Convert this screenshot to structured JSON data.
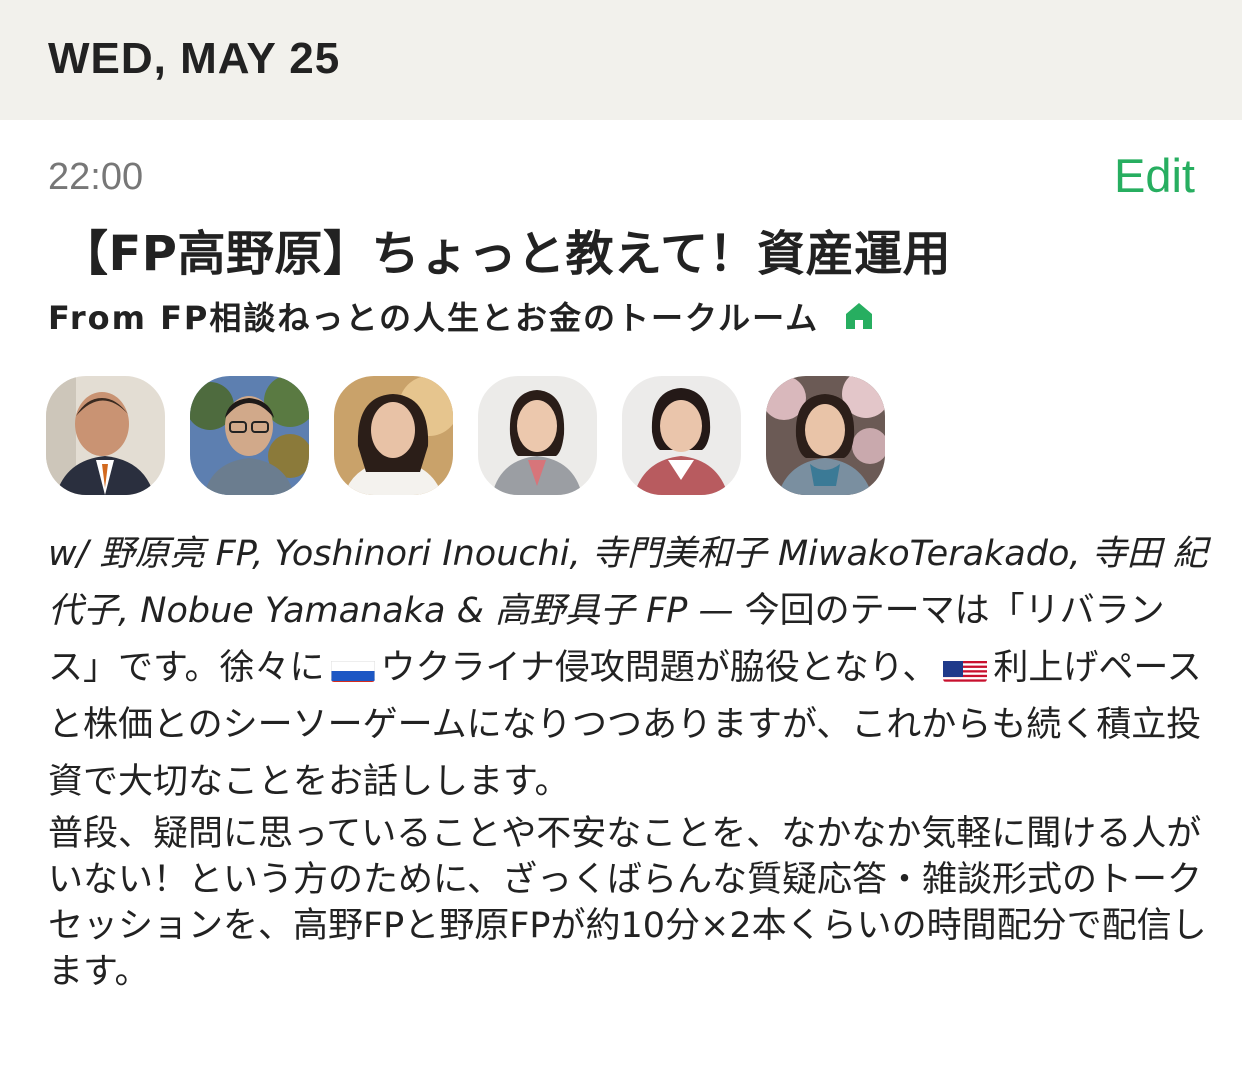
{
  "date_header": "WED, MAY 25",
  "event": {
    "time": "22:00",
    "edit_label": "Edit",
    "title": "【FP高野原】ちょっと教えて！資産運用",
    "from_label": "From FP相談ねっとの人生とお金のトークルーム"
  },
  "hosts": [
    {
      "name": "野原亮 FP"
    },
    {
      "name": "Yoshinori Inouchi"
    },
    {
      "name": "寺門美和子 MiwakoTerakado"
    },
    {
      "name": "寺田 紀代子"
    },
    {
      "name": "Nobue Yamanaka"
    },
    {
      "name": "高野具子 FP"
    }
  ],
  "description": {
    "prefix": "w/ ",
    "sep1": ", ",
    "sep2": ", ",
    "sep3": ", ",
    "sep4": ", ",
    "amp": " & ",
    "dash": " — ",
    "text1": "今回のテーマは「リバランス」です。徐々に",
    "text2": "ウクライナ侵攻問題が脇役となり、",
    "text3": "利上げペースと株価とのシーソーゲームになりつつありますが、これからも続く積立投資で大切なことをお話しします。",
    "text4": "普段、疑問に思っていることや不安なことを、なかなか気軽に聞ける人がいない！という方のために、ざっくばらんな質疑応答・雑談形式のトークセッションを、高野FPと野原FPが約10分×2本くらいの時間配分で配信します。",
    "flag1": "russia-flag",
    "flag2": "usa-flag"
  },
  "colors": {
    "accent": "#27ae60",
    "header_bg": "#f2f1ec",
    "muted": "#777777"
  }
}
